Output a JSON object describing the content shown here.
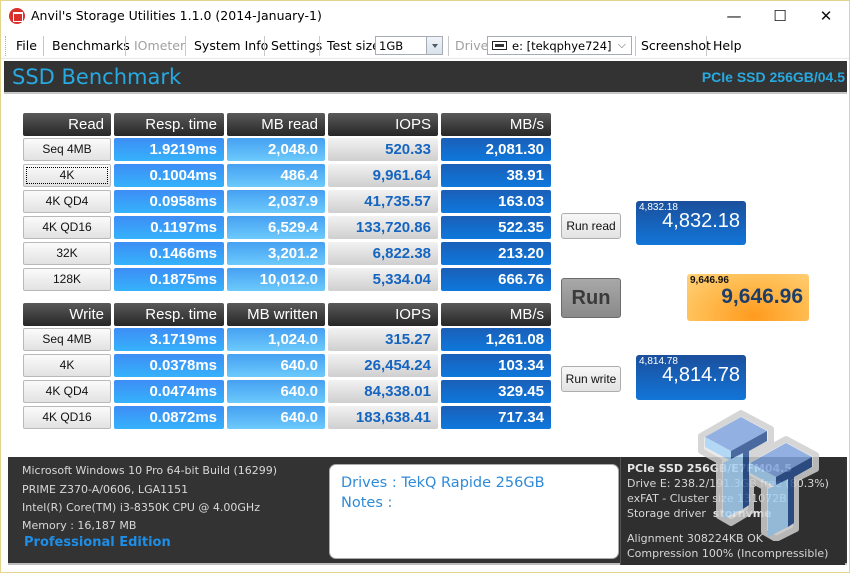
{
  "window": {
    "title": "Anvil's Storage Utilities 1.1.0 (2014-January-1)",
    "controls": {
      "minimize": "—",
      "maximize": "☐",
      "close": "✕"
    }
  },
  "menu": {
    "file": "File",
    "benchmarks": "Benchmarks",
    "iometer": "IOmeter",
    "system_info": "System Info",
    "settings": "Settings",
    "test_size_label": "Test size",
    "test_size_value": "1GB",
    "drive_label": "Drive",
    "drive_value": "e: [tekqphye724]",
    "screenshot": "Screenshot",
    "help": "Help"
  },
  "header": {
    "title": "SSD Benchmark",
    "drive_model": "PCIe  SSD 256GB/04.5"
  },
  "read_table": {
    "headers": [
      "Read",
      "Resp. time",
      "MB read",
      "IOPS",
      "MB/s"
    ],
    "rows": [
      {
        "label": "Seq 4MB",
        "resp": "1.9219ms",
        "mb": "2,048.0",
        "iops": "520.33",
        "mbs": "2,081.30"
      },
      {
        "label": "4K",
        "resp": "0.1004ms",
        "mb": "486.4",
        "iops": "9,961.64",
        "mbs": "38.91"
      },
      {
        "label": "4K QD4",
        "resp": "0.0958ms",
        "mb": "2,037.9",
        "iops": "41,735.57",
        "mbs": "163.03"
      },
      {
        "label": "4K QD16",
        "resp": "0.1197ms",
        "mb": "6,529.4",
        "iops": "133,720.86",
        "mbs": "522.35"
      },
      {
        "label": "32K",
        "resp": "0.1466ms",
        "mb": "3,201.2",
        "iops": "6,822.38",
        "mbs": "213.20"
      },
      {
        "label": "128K",
        "resp": "0.1875ms",
        "mb": "10,012.0",
        "iops": "5,334.04",
        "mbs": "666.76"
      }
    ]
  },
  "write_table": {
    "headers": [
      "Write",
      "Resp. time",
      "MB written",
      "IOPS",
      "MB/s"
    ],
    "rows": [
      {
        "label": "Seq 4MB",
        "resp": "3.1719ms",
        "mb": "1,024.0",
        "iops": "315.27",
        "mbs": "1,261.08"
      },
      {
        "label": "4K",
        "resp": "0.0378ms",
        "mb": "640.0",
        "iops": "26,454.24",
        "mbs": "103.34"
      },
      {
        "label": "4K QD4",
        "resp": "0.0474ms",
        "mb": "640.0",
        "iops": "84,338.01",
        "mbs": "329.45"
      },
      {
        "label": "4K QD16",
        "resp": "0.0872ms",
        "mb": "640.0",
        "iops": "183,638.41",
        "mbs": "717.34"
      }
    ]
  },
  "actions": {
    "run_read": "Run read",
    "run": "Run",
    "run_write": "Run write"
  },
  "scores": {
    "read_small": "4,832.18",
    "read_big": "4,832.18",
    "total_small": "9,646.96",
    "total_big": "9,646.96",
    "write_small": "4,814.78",
    "write_big": "4,814.78"
  },
  "system": {
    "os": "Microsoft Windows 10 Pro 64-bit Build (16299)",
    "board": "PRIME Z370-A/0606, LGA1151",
    "cpu": "Intel(R) Core(TM) i3-8350K CPU @ 4.00GHz",
    "memory": "Memory : 16,187 MB",
    "edition": "Professional Edition"
  },
  "notes": {
    "drives": "Drives : TekQ Rapide 256GB",
    "notes": "Notes :"
  },
  "drive_info": {
    "model": "PCIe SSD 256GB/E7FM04.5",
    "space": "Drive E: 238.2/191.3GB free (80.3%)",
    "fs": "exFAT - Cluster size 131072B",
    "driver_label": "Storage driver",
    "driver": "stornvme",
    "alignment": "Alignment 308224KB OK",
    "compression": "Compression 100% (Incompressible)"
  },
  "colors": {
    "header_bg": "#333333",
    "accent_blue": "#27a9e1",
    "iops_text": "#1565c0",
    "total_score_bg": "#ffb43c"
  }
}
